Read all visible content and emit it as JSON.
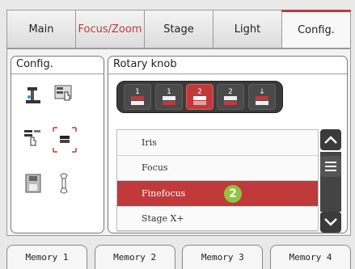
{
  "tabs": [
    {
      "label": "Main"
    },
    {
      "label": "Focus/Zoom"
    },
    {
      "label": "Stage"
    },
    {
      "label": "Light"
    },
    {
      "label": "Config."
    }
  ],
  "config_panel": {
    "title": "Config."
  },
  "rotary_panel": {
    "title": "Rotary knob",
    "knobs": [
      {
        "label": "1"
      },
      {
        "label": "1"
      },
      {
        "label": "2"
      },
      {
        "label": "2"
      },
      {
        "label": "↓"
      }
    ],
    "list_items": [
      {
        "label": "Iris"
      },
      {
        "label": "Focus"
      },
      {
        "label": "Finefocus"
      },
      {
        "label": "Stage X+"
      }
    ],
    "badge": "2"
  },
  "memory": [
    {
      "label": "Memory 1"
    },
    {
      "label": "Memory 2"
    },
    {
      "label": "Memory 3"
    },
    {
      "label": "Memory 4"
    }
  ],
  "colors": {
    "accent": "#c0393b",
    "badge": "#8dc63f"
  }
}
